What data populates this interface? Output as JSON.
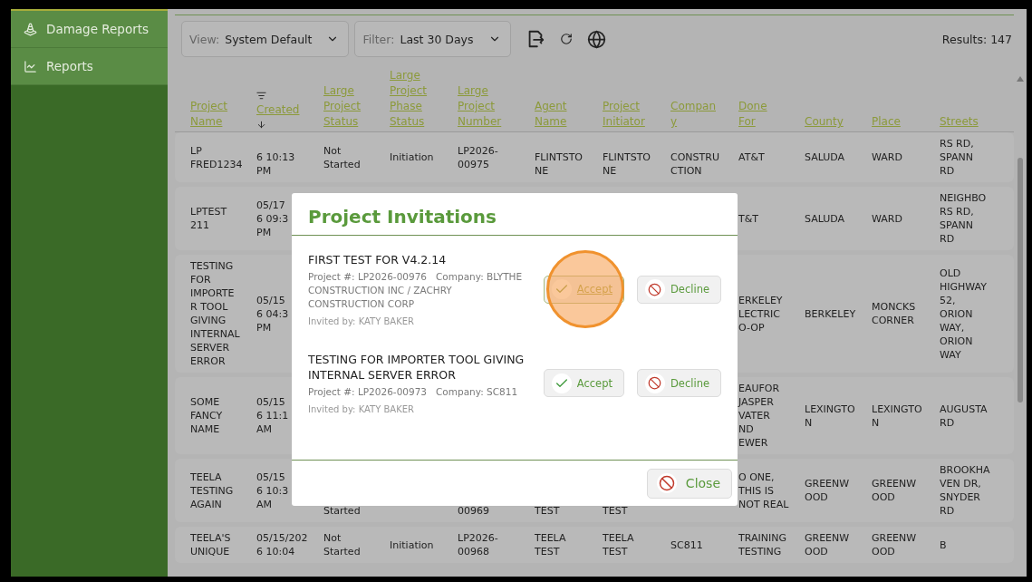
{
  "sidebar": {
    "items": [
      {
        "label": "Damage Reports"
      },
      {
        "label": "Reports"
      }
    ]
  },
  "toolbar": {
    "view": {
      "label": "View:",
      "value": "System Default"
    },
    "filter": {
      "label": "Filter:",
      "value": "Last 30 Days"
    },
    "results": "Results: 147"
  },
  "table": {
    "columns": [
      {
        "label": "Project\nName",
        "sorted": false,
        "filtered": false
      },
      {
        "label": "Created",
        "sorted": true,
        "filtered": true
      },
      {
        "label": "Large\nProject\nStatus",
        "sorted": false,
        "filtered": false
      },
      {
        "label": "Large\nProject\nPhase\nStatus",
        "sorted": false,
        "filtered": false
      },
      {
        "label": "Large\nProject\nNumber",
        "sorted": false,
        "filtered": false
      },
      {
        "label": "Agent\nName",
        "sorted": false,
        "filtered": false
      },
      {
        "label": "Project\nInitiator",
        "sorted": false,
        "filtered": false
      },
      {
        "label": "Compan\ny",
        "sorted": false,
        "filtered": false
      },
      {
        "label": "Done\nFor",
        "sorted": false,
        "filtered": false
      },
      {
        "label": "County",
        "sorted": false,
        "filtered": false
      },
      {
        "label": "Place",
        "sorted": false,
        "filtered": false
      },
      {
        "label": "Streets",
        "sorted": false,
        "filtered": false
      }
    ],
    "rows": [
      {
        "cells": [
          "LP\nFRED1234",
          {
            "text": "6 10:13\nPM",
            "top_covered": true
          },
          "Not\nStarted",
          "Initiation",
          "LP2026-\n00975",
          {
            "text": "FLINTSTO\nNE",
            "top_covered": true
          },
          {
            "text": "FLINTSTO\nNE",
            "top_covered": true
          },
          {
            "text": "CONSTRU\nCTION",
            "top_covered": true
          },
          "AT&T",
          "SALUDA",
          "WARD",
          "RS RD,\nSPANN\nRD"
        ]
      },
      {
        "cells": [
          "LPTEST\n211",
          "05/17\n6 09:3\nPM",
          null,
          null,
          null,
          null,
          null,
          null,
          "T&T",
          "SALUDA",
          "WARD",
          "NEIGHBO\nRS RD,\nSPANN\nRD"
        ]
      },
      {
        "cells": [
          "TESTING\nFOR\nIMPORTE\nR TOOL\nGIVING\nINTERNAL\nSERVER\nERROR",
          "05/15\n6 04:3\nPM",
          null,
          null,
          null,
          null,
          null,
          null,
          "ERKELEY\nLECTRIC\nO-OP",
          "BERKELEY",
          "MONCKS\nCORNER",
          "OLD\nHIGHWAY\n52,\nORION\nWAY,\nORION\nWAY"
        ]
      },
      {
        "cells": [
          "SOME\nFANCY\nNAME",
          "05/15\n6 11:1\nAM",
          null,
          null,
          null,
          null,
          null,
          null,
          "EAUFOR\nJASPER\nVATER\nND\nEWER",
          "LEXINGTO\nN",
          "LEXINGTO\nN",
          "AUGUSTA\nRD"
        ]
      },
      {
        "cells": [
          "TEELA\nTESTING\nAGAIN",
          "05/15\n6 10:3\nAM",
          {
            "text": "Started",
            "top_covered": true
          },
          null,
          {
            "text": "00969",
            "top_covered": true
          },
          {
            "text": "TEST",
            "top_covered": true
          },
          {
            "text": "TEST",
            "top_covered": true
          },
          null,
          "O ONE,\nTHIS IS\nNOT REAL",
          "GREENW\nOOD",
          "GREENW\nOOD",
          "BROOKHA\nVEN DR,\nSNYDER\nRD"
        ]
      },
      {
        "cells": [
          "TEELA'S\nUNIQUE",
          "05/15/202\n6 10:04",
          "Not\nStarted",
          "Initiation",
          "LP2026-\n00968",
          "TEELA\nTEST",
          "TEELA\nTEST",
          "SC811",
          "TRAINING\nTESTING",
          "GREENW\nOOD",
          "GREENW\nOOD",
          "B"
        ]
      }
    ]
  },
  "dialog": {
    "title": "Project Invitations",
    "invitations": [
      {
        "title": "FIRST TEST FOR V4.2.14",
        "project_number": "Project #: LP2026-00976",
        "company": "Company: BLYTHE CONSTRUCTION INC / ZACHRY CONSTRUCTION CORP",
        "invited_by": "Invited by: KATY BAKER",
        "accept": {
          "label": "Accept",
          "hovered": true,
          "clicked": true
        },
        "decline": {
          "label": "Decline"
        }
      },
      {
        "title": "TESTING FOR IMPORTER TOOL GIVING INTERNAL SERVER ERROR",
        "project_number": "Project #: LP2026-00973",
        "company": "Company: SC811",
        "invited_by": "Invited by: KATY BAKER",
        "accept": {
          "label": "Accept",
          "hovered": false,
          "clicked": false
        },
        "decline": {
          "label": "Decline"
        }
      }
    ],
    "close": "Close"
  }
}
